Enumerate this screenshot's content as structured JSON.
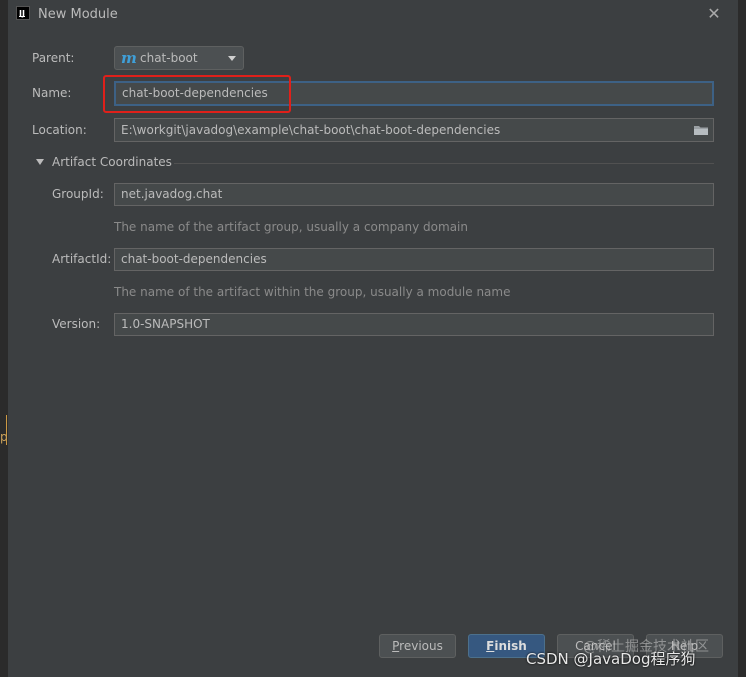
{
  "window": {
    "title": "New Module"
  },
  "form": {
    "parent_label": "Parent:",
    "parent_value": "chat-boot",
    "name_label": "Name:",
    "name_value": "chat-boot-dependencies",
    "location_label": "Location:",
    "location_value": "E:\\workgit\\javadog\\example\\chat-boot\\chat-boot-dependencies"
  },
  "artifact": {
    "section_title": "Artifact Coordinates",
    "groupid_label": "GroupId:",
    "groupid_value": "net.javadog.chat",
    "groupid_hint": "The name of the artifact group, usually a company domain",
    "artifactid_label": "ArtifactId:",
    "artifactid_value": "chat-boot-dependencies",
    "artifactid_hint": "The name of the artifact within the group, usually a module name",
    "version_label": "Version:",
    "version_value": "1.0-SNAPSHOT"
  },
  "buttons": {
    "previous_u": "P",
    "previous_rest": "revious",
    "finish_u": "F",
    "finish_rest": "inish",
    "cancel": "Cancel",
    "help": "Help"
  },
  "watermarks": {
    "line1": "@稀土掘金技术社区",
    "line2": "CSDN @JavaDog程序狗"
  },
  "left_edge_glyph": "p",
  "colors": {
    "background": "#3c3f41",
    "field_background": "#45494a",
    "focus_border": "#3d6185",
    "highlight_red": "#e0201a",
    "finish_button": "#365880",
    "maven_icon": "#3f9fd8"
  },
  "icons": [
    "app-logo-icon",
    "close-icon",
    "maven-icon",
    "chevron-down-icon",
    "folder-icon",
    "collapse-triangle-icon"
  ]
}
